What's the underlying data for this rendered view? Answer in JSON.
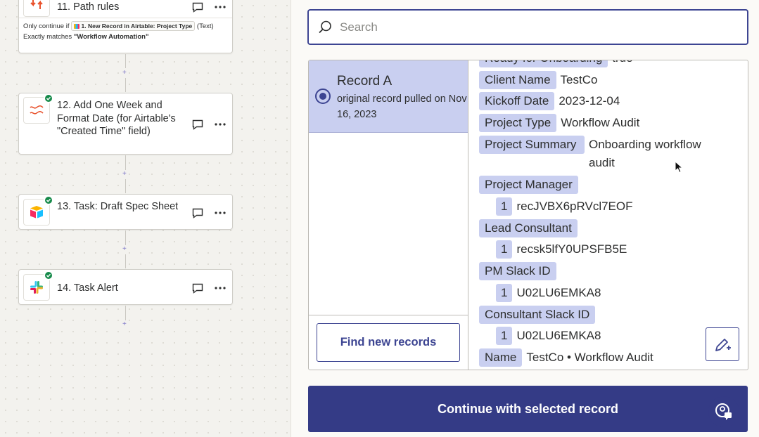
{
  "steps": [
    {
      "title": "11. Path rules",
      "note_prefix": "Only continue if",
      "note_pill": "1. New Record in Airtable: Project Type",
      "note_type": "(Text)",
      "note_line2_prefix": "Exactly matches",
      "note_line2_value": "\"Workflow Automation\""
    },
    {
      "title": "12. Add One Week and Format Date (for Airtable's \"Created Time\" field)"
    },
    {
      "title": "13. Task: Draft Spec Sheet"
    },
    {
      "title": "14. Task Alert"
    }
  ],
  "icons": {
    "path": "path-rules-icon",
    "formatter": "formatter-icon",
    "airtable": "airtable-icon",
    "slack": "slack-icon"
  },
  "search": {
    "placeholder": "Search"
  },
  "record": {
    "title": "Record A",
    "subtitle": "original record pulled on Nov 16, 2023"
  },
  "fields": [
    {
      "key": "Ready for Onboarding",
      "value": "true"
    },
    {
      "key": "Client Name",
      "value": "TestCo"
    },
    {
      "key": "Kickoff Date",
      "value": "2023-12-04"
    },
    {
      "key": "Project Type",
      "value": "Workflow Audit"
    },
    {
      "key": "Project Summary",
      "value": "Onboarding workflow audit"
    },
    {
      "key": "Project Manager",
      "index": "1",
      "value": "recJVBX6pRVcl7EOF"
    },
    {
      "key": "Lead Consultant",
      "index": "1",
      "value": "recsk5lfY0UPSFB5E"
    },
    {
      "key": "PM Slack ID",
      "index": "1",
      "value": "U02LU6EMKA8"
    },
    {
      "key": "Consultant Slack ID",
      "index": "1",
      "value": "U02LU6EMKA8"
    },
    {
      "key": "Name",
      "value": "TestCo • Workflow Audit"
    }
  ],
  "buttons": {
    "find_new": "Find new records",
    "continue": "Continue with selected record"
  },
  "colors": {
    "accent": "#3d4592",
    "highlight": "#c9cff0",
    "success": "#168a4a"
  }
}
